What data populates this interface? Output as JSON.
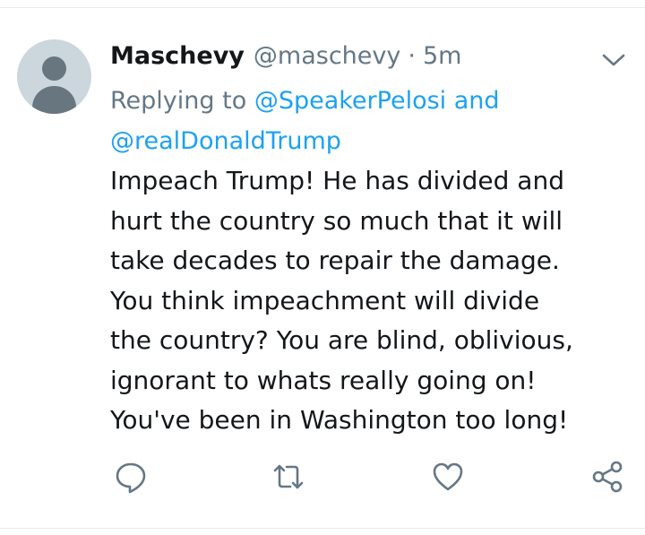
{
  "tweet": {
    "display_name": "Maschevy",
    "handle": "@maschevy",
    "separator": "·",
    "time": "5m",
    "reply": {
      "prefix": "Replying to",
      "mention_1": "@SpeakerPelosi",
      "conjunction": "and",
      "mention_2": "@realDonaldTrump"
    },
    "text_lines": [
      "Impeach Trump! He has divided and",
      "hurt the country so much that it will",
      "take decades to repair the damage.",
      "You think impeachment will divide",
      "the country? You are blind, oblivious,",
      "ignorant to whats really going on!",
      "You've been in Washington too long!"
    ]
  },
  "icons": {
    "menu": "chevron-down-icon",
    "reply": "reply-icon",
    "retweet": "retweet-icon",
    "like": "heart-icon",
    "share": "share-icon"
  },
  "colors": {
    "text": "#14171a",
    "muted": "#657786",
    "link": "#1da1f2",
    "avatar_bg": "#ccd6dd",
    "avatar_fg": "#68767f",
    "divider": "#e6ecf0"
  }
}
